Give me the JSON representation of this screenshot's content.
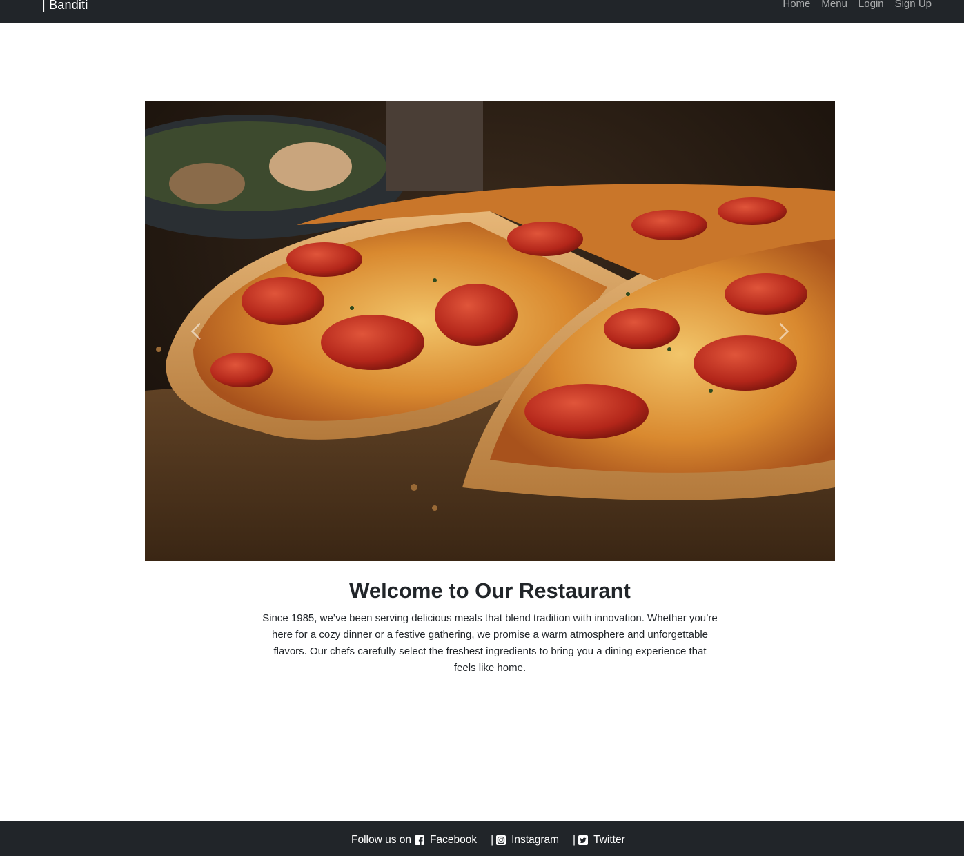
{
  "navbar": {
    "brand": "| Banditi",
    "links": [
      "Home",
      "Menu",
      "Login",
      "Sign Up"
    ]
  },
  "carousel": {
    "prev_icon": "chevron-left-icon",
    "next_icon": "chevron-right-icon"
  },
  "welcome": {
    "title": "Welcome to Our Restaurant",
    "text": "Since 1985, we’ve been serving delicious meals that blend tradition with innovation. Whether you’re here for a cozy dinner or a festive gathering, we promise a warm atmosphere and unforgettable flavors. Our chefs carefully select the freshest ingredients to bring you a dining experience that feels like home."
  },
  "footer": {
    "follow_label": "Follow us on",
    "separator": "|",
    "facebook": "Facebook",
    "instagram": "Instagram",
    "twitter": "Twitter"
  },
  "colors": {
    "dark": "#212529",
    "white": "#ffffff",
    "nav_link": "rgba(255,255,255,0.62)"
  }
}
